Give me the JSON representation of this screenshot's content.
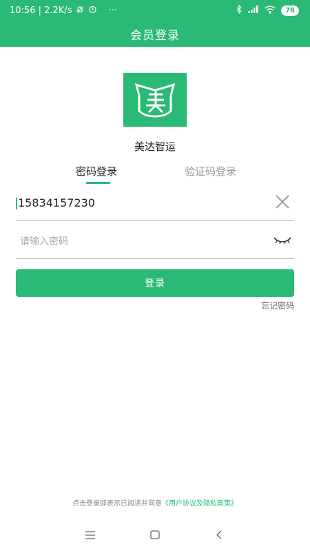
{
  "status_bar": {
    "time_speed": "10:56 | 2.2K/s",
    "more": "···",
    "battery": "78"
  },
  "header": {
    "title": "会员登录"
  },
  "app": {
    "name": "美达智运"
  },
  "tabs": [
    {
      "label": "密码登录",
      "active": true
    },
    {
      "label": "验证码登录",
      "active": false
    }
  ],
  "form": {
    "phone_value": "15834157230",
    "password_placeholder": "请输入密码",
    "login_label": "登录",
    "forgot_label": "忘记密码"
  },
  "footer": {
    "agreement_text": "点击登录即表示已阅读并同意",
    "agreement_link": "《用户协议及隐私政策》"
  },
  "colors": {
    "brand": "#2aba76"
  }
}
